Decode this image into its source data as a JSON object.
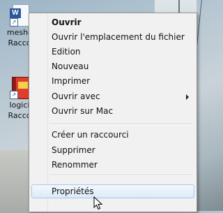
{
  "desktop": {
    "icons": [
      {
        "label_line1": "meshc",
        "label_line2": "Racco",
        "icon": "word-document-icon",
        "badge": "W"
      },
      {
        "label_line1": "logici",
        "label_line2": "Racco",
        "icon": "book-icon"
      }
    ]
  },
  "context_menu": {
    "items": [
      {
        "label": "Ouvrir",
        "bold": true
      },
      {
        "label": "Ouvrir l'emplacement du fichier"
      },
      {
        "label": "Edition"
      },
      {
        "label": "Nouveau"
      },
      {
        "label": "Imprimer"
      },
      {
        "label": "Ouvrir avec",
        "has_submenu": true
      },
      {
        "label": "Ouvrir sur Mac"
      },
      {
        "label": "Créer un raccourci"
      },
      {
        "label": "Supprimer"
      },
      {
        "label": "Renommer"
      },
      {
        "label": "Propriétés",
        "highlighted": true
      }
    ]
  },
  "colors": {
    "menu_background": "#f1f1f1",
    "highlight": "#dceaf8",
    "highlight_border": "#a9c7e8"
  }
}
